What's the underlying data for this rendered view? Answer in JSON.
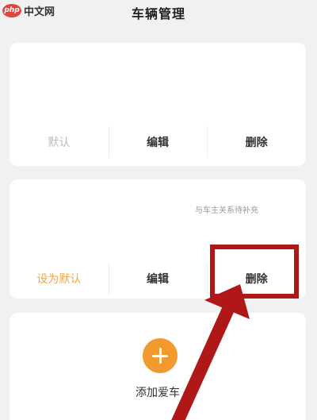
{
  "watermark": {
    "logo": "php",
    "text": "中文网"
  },
  "header": {
    "title": "车辆管理"
  },
  "vehicles": [
    {
      "note": "",
      "actions": {
        "default": "默认",
        "edit": "编辑",
        "delete": "删除"
      }
    },
    {
      "note": "与车主关系待补充",
      "actions": {
        "default": "设为默认",
        "edit": "编辑",
        "delete": "删除"
      }
    }
  ],
  "add": {
    "label": "添加爱车",
    "icon": "plus-icon"
  },
  "colors": {
    "accent": "#f29a2e",
    "annotation": "#b01818",
    "default_text": "#f3a54a"
  }
}
